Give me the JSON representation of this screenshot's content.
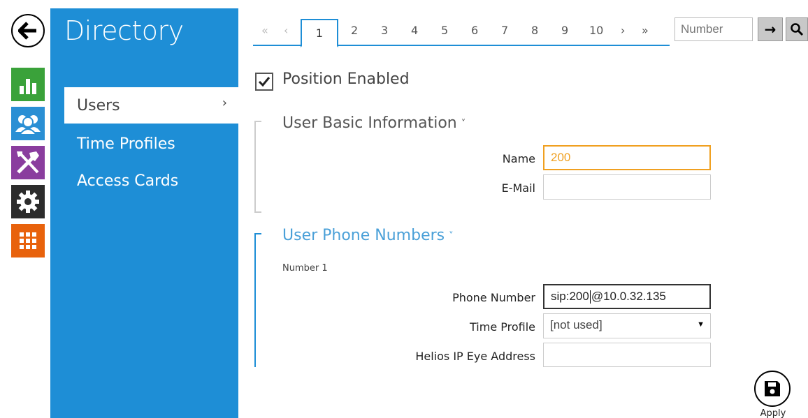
{
  "app": {
    "title": "Directory"
  },
  "rail": {
    "items": [
      {
        "icon": "back-arrow-icon"
      },
      {
        "icon": "bar-chart-icon",
        "color": "#3aa23a"
      },
      {
        "icon": "users-icon",
        "color": "#2a8fd4"
      },
      {
        "icon": "tools-icon",
        "color": "#8a3d9e"
      },
      {
        "icon": "gear-icon",
        "color": "#2c2c2c"
      },
      {
        "icon": "grid-icon",
        "color": "#e8620c"
      }
    ]
  },
  "sidebar": {
    "items": [
      {
        "label": "Users",
        "active": true,
        "chevron": "›"
      },
      {
        "label": "Time Profiles"
      },
      {
        "label": "Access Cards"
      }
    ]
  },
  "pager": {
    "first": "«",
    "prev": "‹",
    "pages": [
      "1",
      "2",
      "3",
      "4",
      "5",
      "6",
      "7",
      "8",
      "9",
      "10"
    ],
    "active_page": "1",
    "next": "›",
    "last": "»",
    "number_placeholder": "Number",
    "go_symbol": "→"
  },
  "form": {
    "position_enabled_label": "Position Enabled",
    "position_enabled": true,
    "basic_section": {
      "title": "User Basic Information",
      "chevron": "˅",
      "name_label": "Name",
      "name_value": "200",
      "email_label": "E-Mail",
      "email_value": ""
    },
    "phone_section": {
      "title": "User Phone Numbers",
      "chevron": "˅",
      "sub_label": "Number 1",
      "phone_label": "Phone Number",
      "phone_value_before_caret": "sip:200",
      "phone_value_after_caret": "@10.0.32.135",
      "time_profile_label": "Time Profile",
      "time_profile_value": "[not used]",
      "helios_label": "Helios IP Eye Address",
      "helios_value": ""
    }
  },
  "apply": {
    "label": "Apply"
  },
  "colors": {
    "accent": "#1e8ed6",
    "highlight": "#f0a020"
  }
}
